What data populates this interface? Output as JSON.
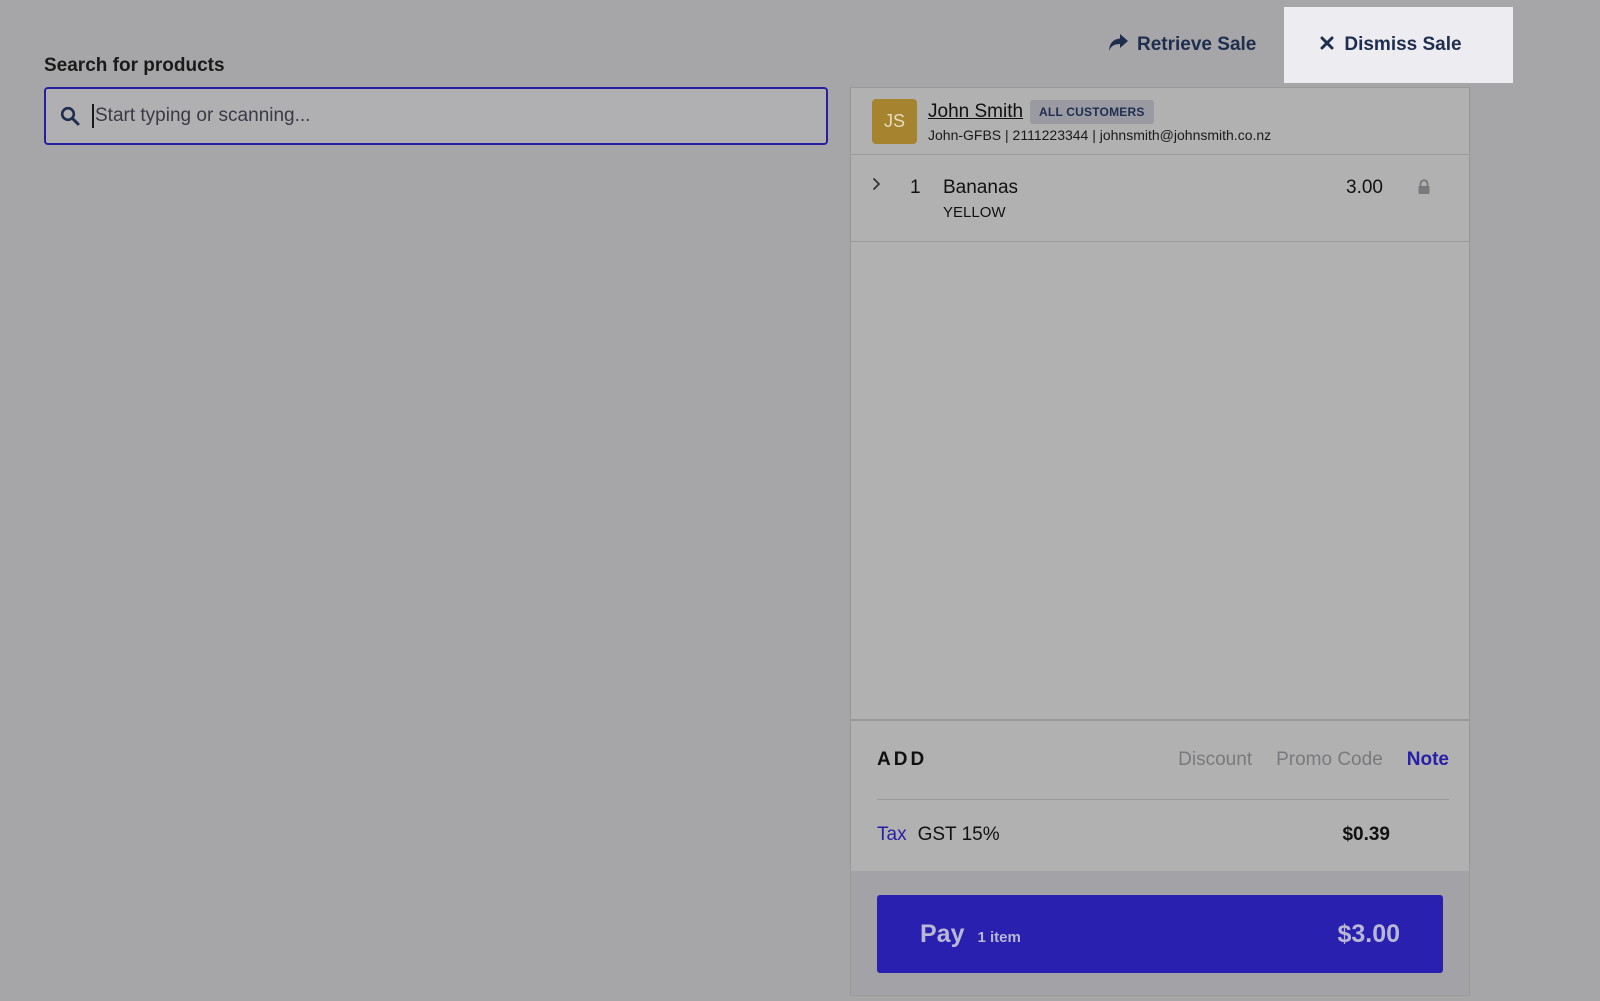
{
  "header": {
    "retrieve_label": "Retrieve Sale",
    "dismiss_label": "Dismiss Sale"
  },
  "search": {
    "label": "Search for products",
    "placeholder": "Start typing or scanning..."
  },
  "customer": {
    "initials": "JS",
    "name": "John Smith",
    "group": "ALL CUSTOMERS",
    "details": "John-GFBS | 2111223344 | johnsmith@johnsmith.co.nz",
    "avatar_color": "#a6842f"
  },
  "line_items": [
    {
      "quantity": "1",
      "name": "Bananas",
      "variant": "YELLOW",
      "price": "3.00"
    }
  ],
  "add": {
    "title": "ADD",
    "options": [
      "Discount",
      "Promo Code",
      "Note"
    ]
  },
  "tax": {
    "label": "Tax",
    "name": "GST 15%",
    "amount": "$0.39"
  },
  "pay": {
    "label": "Pay",
    "count": "1 item",
    "total": "$3.00",
    "color": "#2920af"
  },
  "icons": {
    "retrieve": "share-arrow-icon",
    "dismiss": "close-icon",
    "search": "search-icon",
    "expand": "chevron-right-icon",
    "lock": "lock-icon"
  }
}
